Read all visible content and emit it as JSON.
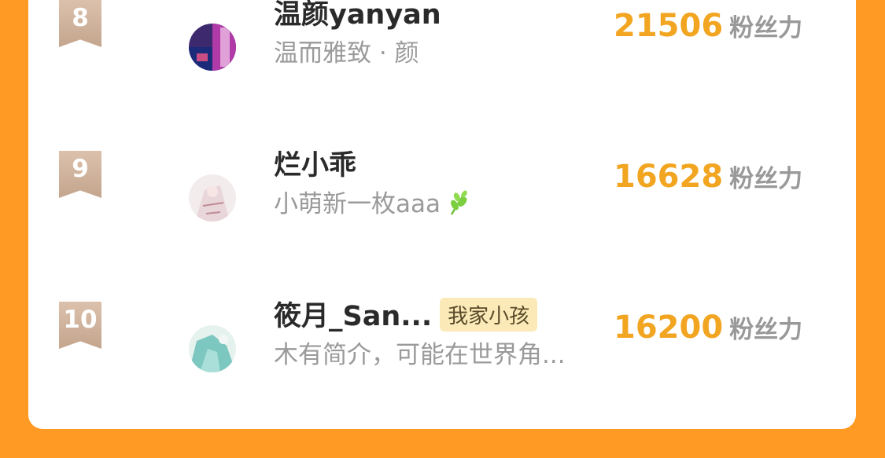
{
  "leaderboard": {
    "rows": [
      {
        "rank": "8",
        "name": "温颜yanyan",
        "bio": "温而雅致 · 颜",
        "score": "21506",
        "score_unit": "粉丝力",
        "tag": "",
        "avatar": "avatar-night-photo"
      },
      {
        "rank": "9",
        "name": "烂小乖",
        "bio": "小萌新一枚aaa",
        "score": "16628",
        "score_unit": "粉丝力",
        "tag": "",
        "bio_icon": "leaf-icon",
        "avatar": "avatar-sketch"
      },
      {
        "rank": "10",
        "name": "筱月_San...",
        "bio": "木有简介，可能在世界角...",
        "score": "16200",
        "score_unit": "粉丝力",
        "tag": "我家小孩",
        "avatar": "avatar-teal-art"
      }
    ]
  },
  "colors": {
    "background": "#ff9a24",
    "card": "#ffffff",
    "score": "#f2a521",
    "rank_badge": "#cfb39d",
    "tag_bg": "#fbeab8"
  }
}
